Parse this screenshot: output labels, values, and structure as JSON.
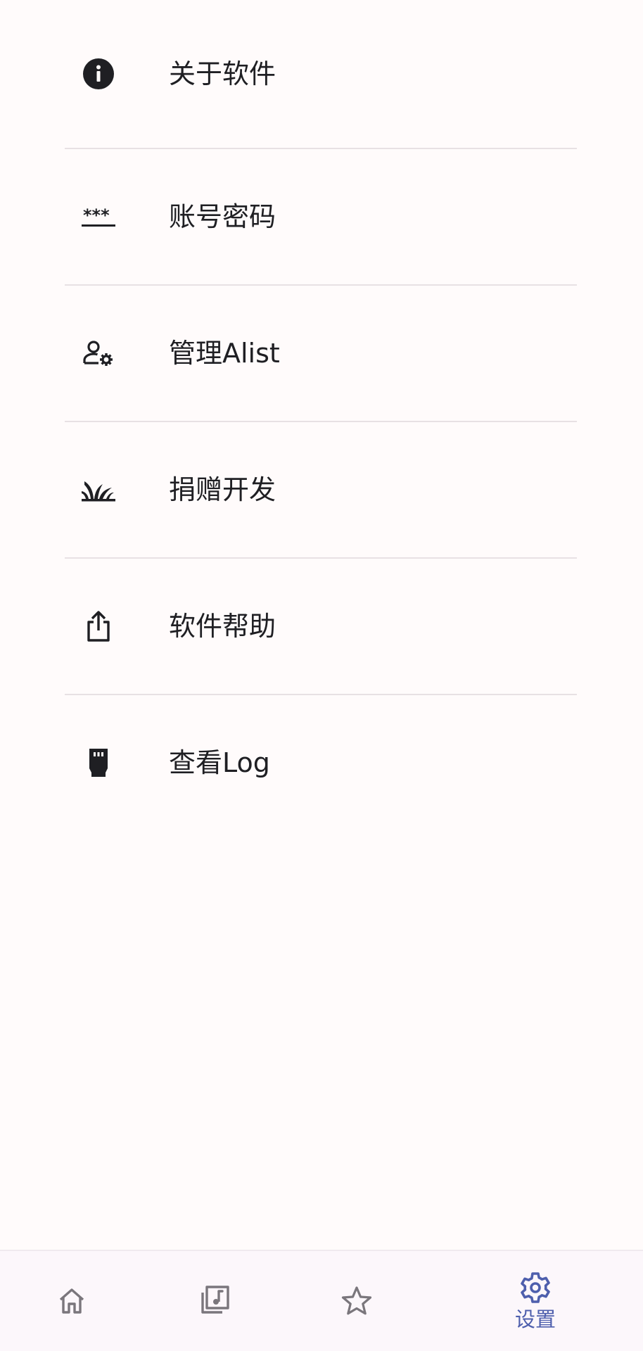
{
  "settings": {
    "items": [
      {
        "label": "关于软件",
        "icon": "info-icon"
      },
      {
        "label": "账号密码",
        "icon": "password-icon"
      },
      {
        "label": "管理Alist",
        "icon": "manage-accounts-icon"
      },
      {
        "label": "捐赠开发",
        "icon": "grass-icon"
      },
      {
        "label": "软件帮助",
        "icon": "share-icon"
      },
      {
        "label": "查看Log",
        "icon": "log-icon"
      }
    ]
  },
  "bottom_nav": {
    "items": [
      {
        "icon": "home-icon",
        "label": ""
      },
      {
        "icon": "music-library-icon",
        "label": ""
      },
      {
        "icon": "star-icon",
        "label": ""
      },
      {
        "icon": "gear-icon",
        "label": "设置",
        "active": true
      }
    ]
  },
  "colors": {
    "background": "#fffbfb",
    "text": "#1f1f23",
    "divider": "#e8e1e4",
    "nav_inactive": "#7a767c",
    "nav_active": "#4e5fad"
  }
}
